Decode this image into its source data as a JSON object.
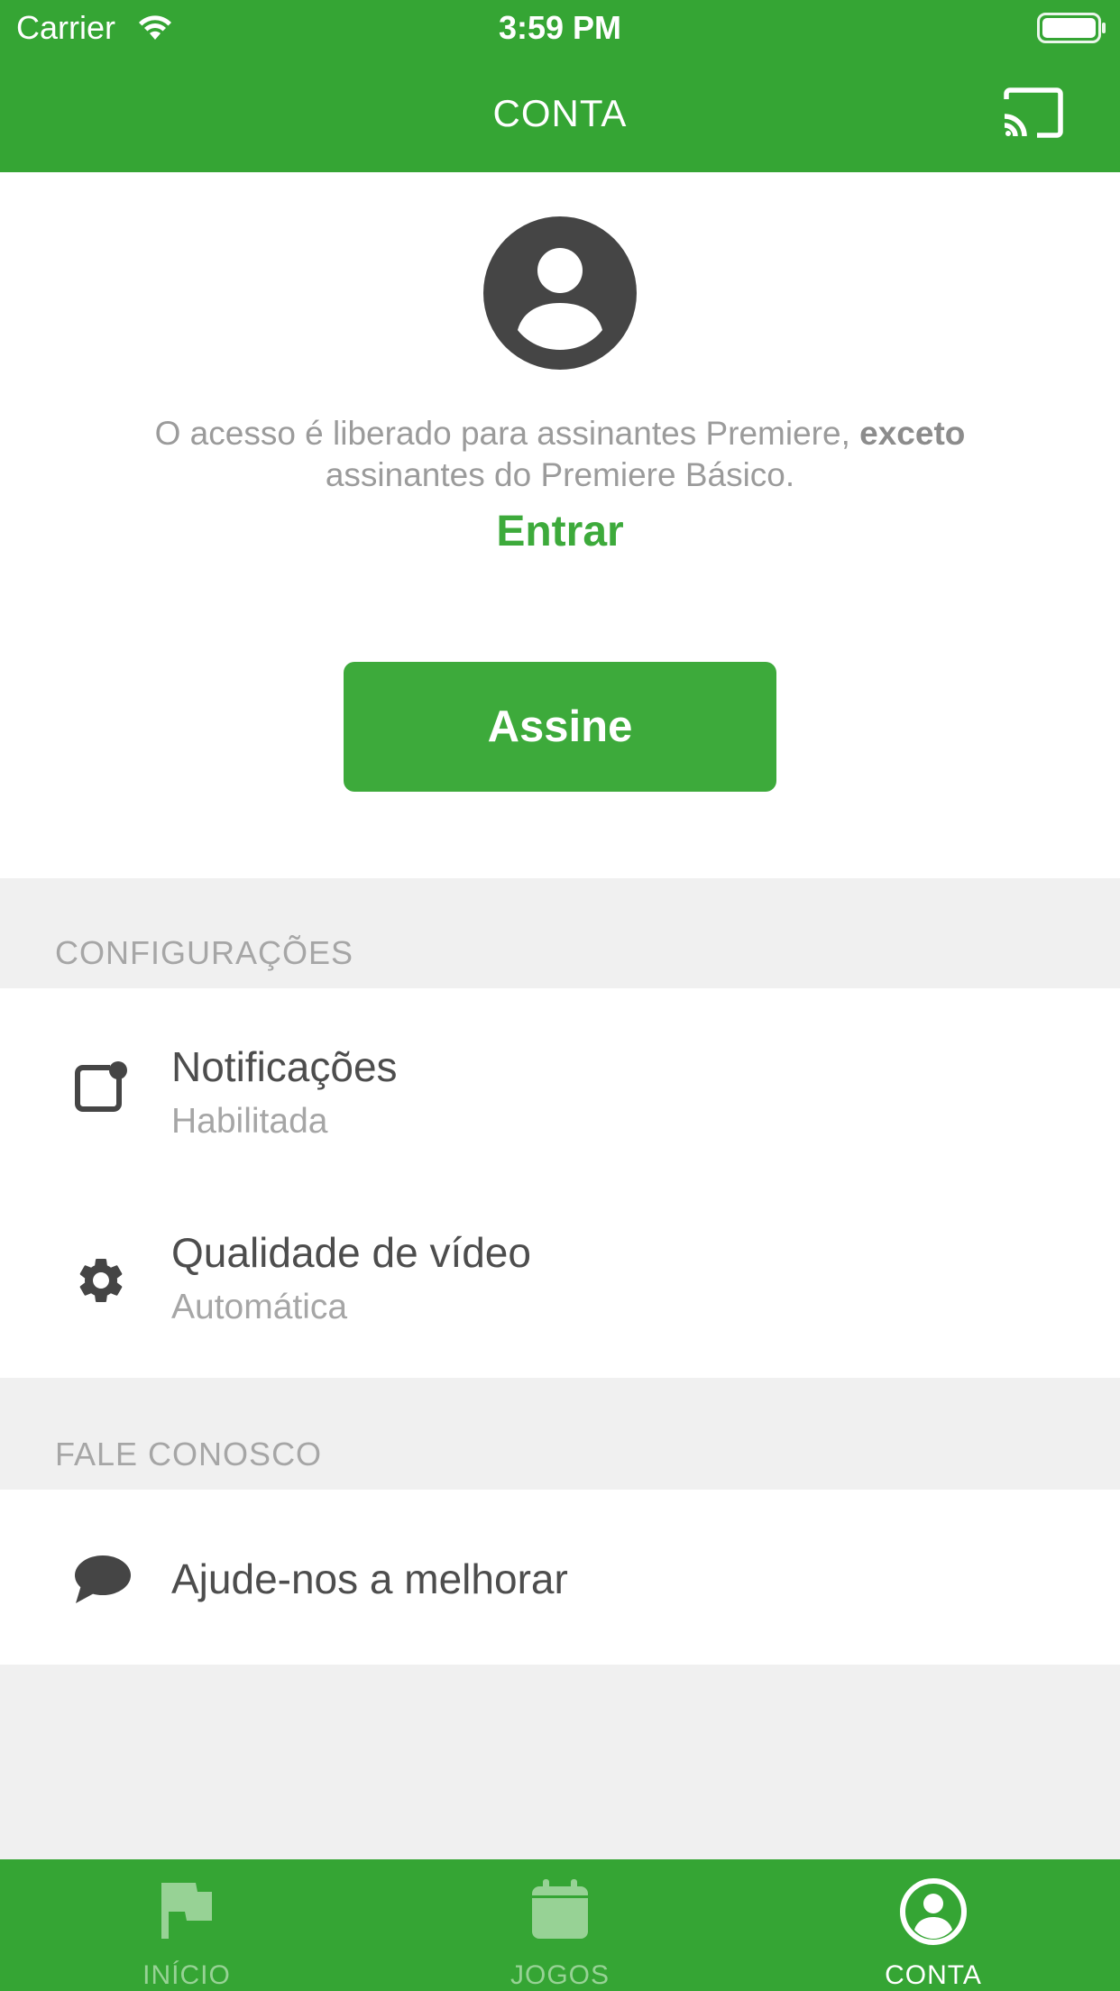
{
  "status_bar": {
    "carrier": "Carrier",
    "time": "3:59 PM"
  },
  "header": {
    "title": "CONTA",
    "cast_icon": "cast-icon"
  },
  "account": {
    "avatar_icon": "account-circle-icon",
    "info_text_before": "O acesso é liberado para assinantes Premiere, ",
    "info_text_bold": "exceto",
    "info_text_after": "assinantes do Premiere Básico.",
    "login_link": "Entrar",
    "subscribe_button": "Assine"
  },
  "settings": {
    "header": "CONFIGURAÇÕES",
    "items": [
      {
        "icon": "notification-badge-icon",
        "title": "Notificações",
        "subtitle": "Habilitada"
      },
      {
        "icon": "gear-icon",
        "title": "Qualidade de vídeo",
        "subtitle": "Automática"
      }
    ]
  },
  "contact": {
    "header": "FALE CONOSCO",
    "items": [
      {
        "icon": "chat-bubble-icon",
        "title": "Ajude-nos a melhorar"
      }
    ]
  },
  "tabbar": {
    "tabs": [
      {
        "icon": "flag-icon",
        "label": "INÍCIO",
        "active": false
      },
      {
        "icon": "calendar-icon",
        "label": "JOGOS",
        "active": false
      },
      {
        "icon": "account-circle-icon",
        "label": "CONTA",
        "active": true
      }
    ]
  },
  "colors": {
    "brand_green": "#35a534",
    "accent_green": "#3daa3b",
    "background": "#f0f0f0"
  }
}
